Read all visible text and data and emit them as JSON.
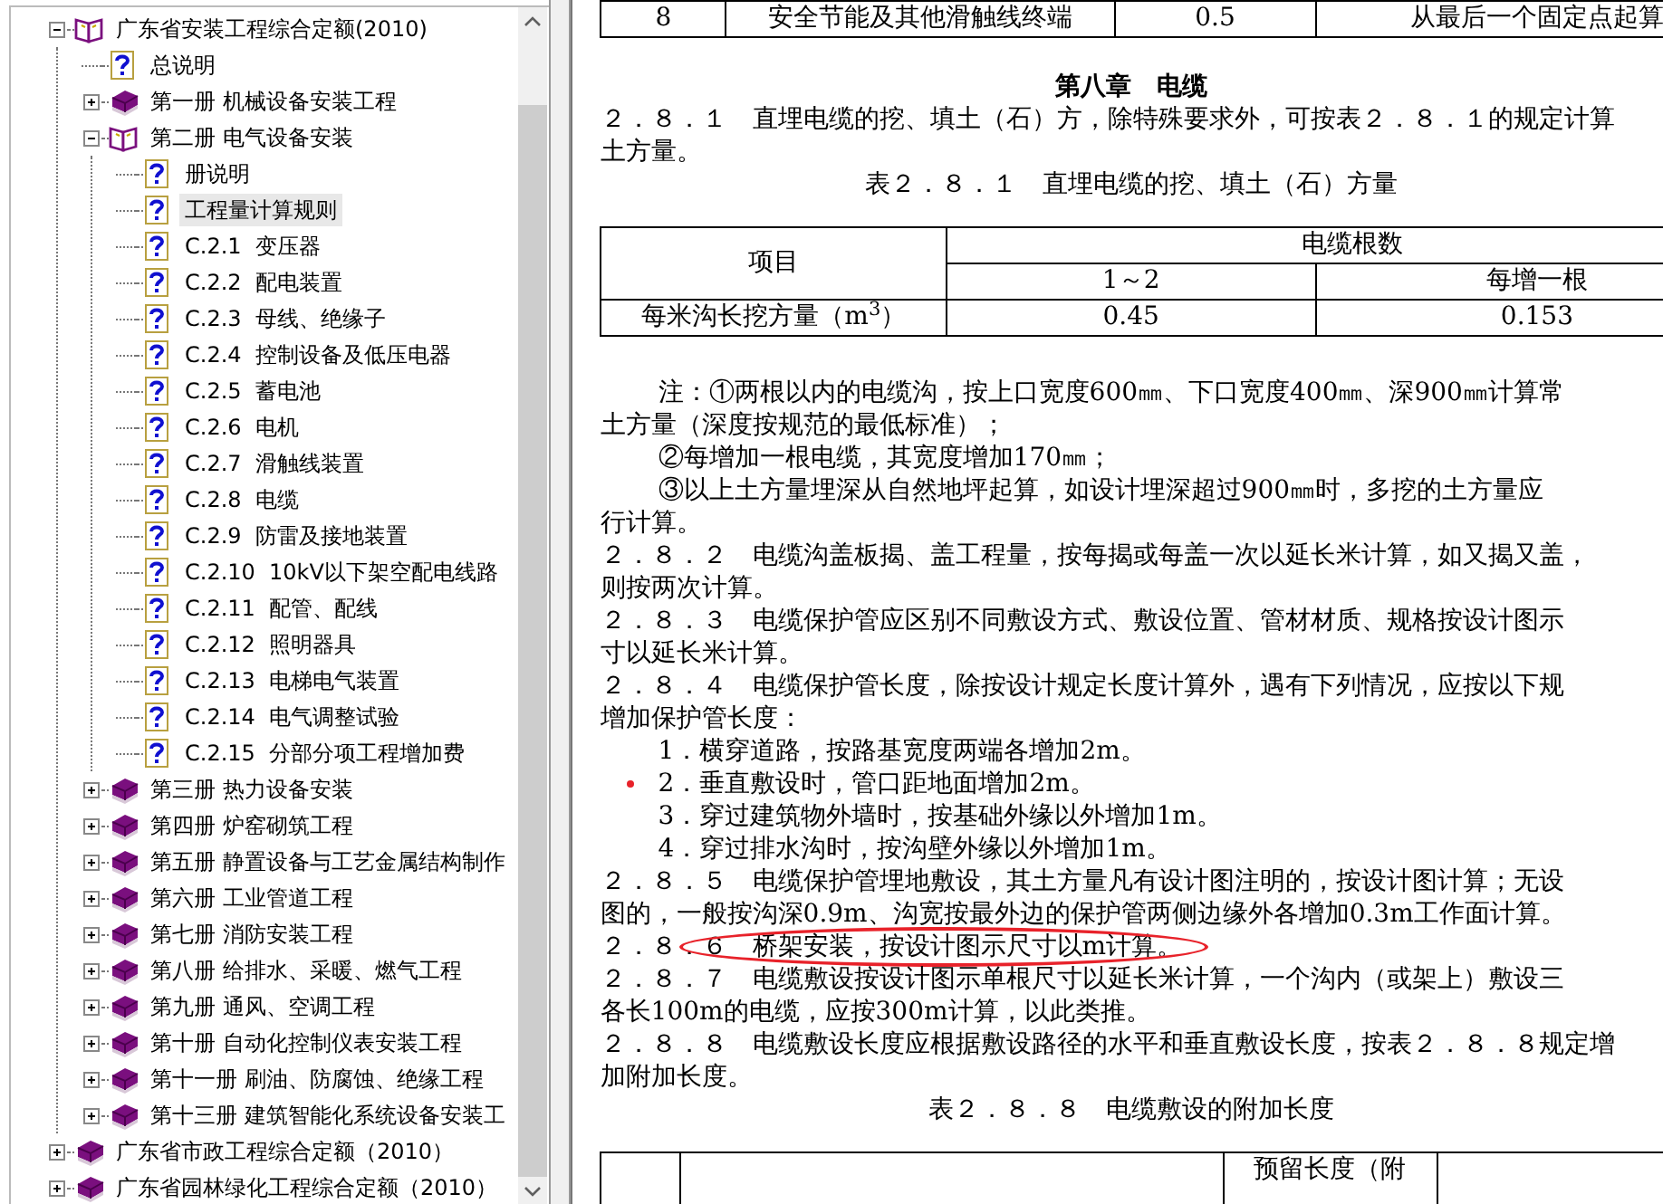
{
  "tree": [
    {
      "label": "广东省安装工程综合定额(2010)",
      "kind": "book",
      "expanded": true,
      "selected": false,
      "children": [
        {
          "label": "总说明",
          "kind": "page",
          "selected": false
        },
        {
          "label": "第一册 机械设备安装工程",
          "kind": "book",
          "expanded": false,
          "selected": false
        },
        {
          "label": "第二册 电气设备安装",
          "kind": "book",
          "expanded": true,
          "selected": false,
          "children": [
            {
              "label": "册说明",
              "kind": "page",
              "selected": false
            },
            {
              "label": "工程量计算规则",
              "kind": "page",
              "selected": true
            },
            {
              "label": "C.2.1  变压器",
              "kind": "page",
              "selected": false
            },
            {
              "label": "C.2.2  配电装置",
              "kind": "page",
              "selected": false
            },
            {
              "label": "C.2.3  母线、绝缘子",
              "kind": "page",
              "selected": false
            },
            {
              "label": "C.2.4  控制设备及低压电器",
              "kind": "page",
              "selected": false
            },
            {
              "label": "C.2.5  蓄电池",
              "kind": "page",
              "selected": false
            },
            {
              "label": "C.2.6  电机",
              "kind": "page",
              "selected": false
            },
            {
              "label": "C.2.7  滑触线装置",
              "kind": "page",
              "selected": false
            },
            {
              "label": "C.2.8  电缆",
              "kind": "page",
              "selected": false
            },
            {
              "label": "C.2.9  防雷及接地装置",
              "kind": "page",
              "selected": false
            },
            {
              "label": "C.2.10  10kV以下架空配电线路",
              "kind": "page",
              "selected": false
            },
            {
              "label": "C.2.11  配管、配线",
              "kind": "page",
              "selected": false
            },
            {
              "label": "C.2.12  照明器具",
              "kind": "page",
              "selected": false
            },
            {
              "label": "C.2.13  电梯电气装置",
              "kind": "page",
              "selected": false
            },
            {
              "label": "C.2.14  电气调整试验",
              "kind": "page",
              "selected": false
            },
            {
              "label": "C.2.15  分部分项工程增加费",
              "kind": "page",
              "selected": false
            }
          ]
        },
        {
          "label": "第三册 热力设备安装",
          "kind": "book",
          "expanded": false,
          "selected": false
        },
        {
          "label": "第四册 炉窑砌筑工程",
          "kind": "book",
          "expanded": false,
          "selected": false
        },
        {
          "label": "第五册 静置设备与工艺金属结构制作",
          "kind": "book",
          "expanded": false,
          "selected": false
        },
        {
          "label": "第六册 工业管道工程",
          "kind": "book",
          "expanded": false,
          "selected": false
        },
        {
          "label": "第七册 消防安装工程",
          "kind": "book",
          "expanded": false,
          "selected": false
        },
        {
          "label": "第八册 给排水、采暖、燃气工程",
          "kind": "book",
          "expanded": false,
          "selected": false
        },
        {
          "label": "第九册 通风、空调工程",
          "kind": "book",
          "expanded": false,
          "selected": false
        },
        {
          "label": "第十册 自动化控制仪表安装工程",
          "kind": "book",
          "expanded": false,
          "selected": false
        },
        {
          "label": "第十一册 刷油、防腐蚀、绝缘工程",
          "kind": "book",
          "expanded": false,
          "selected": false
        },
        {
          "label": "第十三册 建筑智能化系统设备安装工",
          "kind": "book",
          "expanded": false,
          "selected": false
        }
      ]
    },
    {
      "label": "广东省市政工程综合定额（2010）",
      "kind": "book",
      "expanded": false,
      "selected": false
    },
    {
      "label": "广东省园林绿化工程综合定额（2010）",
      "kind": "book",
      "expanded": false,
      "selected": false
    }
  ],
  "content": [
    {
      "kind": "table",
      "rows": [
        [
          "8",
          "安全节能及其他滑触线终端",
          "0.5",
          "从最后一个固定点起算"
        ]
      ]
    },
    {
      "kind": "heading",
      "text": "第八章　电缆"
    },
    {
      "kind": "line",
      "text": "２．８．１　直埋电缆的挖、填土（石）方，除特殊要求外，可按表２．８．１的规定计算"
    },
    {
      "kind": "line",
      "text": "土方量。"
    },
    {
      "kind": "caption",
      "text": "表２．８．１　直埋电缆的挖、填土（石）方量"
    },
    {
      "kind": "group_table",
      "row_header": "项目",
      "group": "电缆根数",
      "subheaders": [
        "1～2",
        "每增一根"
      ],
      "rows": [
        [
          "每米沟长挖方量（m$^{3}$）",
          "0.45",
          "0.153"
        ]
      ]
    },
    {
      "kind": "indented",
      "text": "注：①两根以内的电缆沟，按上口宽度600㎜、下口宽度400㎜、深900㎜计算常"
    },
    {
      "kind": "line",
      "text": "土方量（深度按规范的最低标准）；"
    },
    {
      "kind": "indented",
      "text": "②每增加一根电缆，其宽度增加170㎜；"
    },
    {
      "kind": "indented",
      "text": "③以上土方量埋深从自然地坪起算，如设计埋深超过900㎜时，多挖的土方量应"
    },
    {
      "kind": "line",
      "text": "行计算。"
    },
    {
      "kind": "line",
      "text": "２．８．２　电缆沟盖板揭、盖工程量，按每揭或每盖一次以延长米计算，如又揭又盖，"
    },
    {
      "kind": "line",
      "text": "则按两次计算。"
    },
    {
      "kind": "line",
      "text": "２．８．３　电缆保护管应区别不同敷设方式、敷设位置、管材材质、规格按设计图示"
    },
    {
      "kind": "line",
      "text": "寸以延长米计算。"
    },
    {
      "kind": "line",
      "text": "２．８．４　电缆保护管长度，除按设计规定长度计算外，遇有下列情况，应按以下规"
    },
    {
      "kind": "line",
      "text": "增加保护管长度："
    },
    {
      "kind": "indented",
      "text": "1．横穿道路，按路基宽度两端各增加2m。"
    },
    {
      "kind": "indented",
      "text": "2．垂直敷设时，管口距地面增加2m。",
      "marker": true
    },
    {
      "kind": "indented",
      "text": "3．穿过建筑物外墙时，按基础外缘以外增加1m。"
    },
    {
      "kind": "indented",
      "text": "4．穿过排水沟时，按沟壁外缘以外增加1m。"
    },
    {
      "kind": "line",
      "text": "２．８．５　电缆保护管埋地敷设，其土方量凡有设计图注明的，按设计图计算；无设"
    },
    {
      "kind": "line",
      "text": "图的，一般按沟深0.9m、沟宽按最外边的保护管两侧边缘外各增加0.3m工作面计算。"
    },
    {
      "kind": "line",
      "text": "２．８．６　桥架安装，按设计图示尺寸以m计算。",
      "circled": true
    },
    {
      "kind": "line",
      "text": "２．８．７　电缆敷设按设计图示单根尺寸以延长米计算，一个沟内（或架上）敷设三"
    },
    {
      "kind": "line",
      "text": "各长100m的电缆，应按300m计算，以此类推。"
    },
    {
      "kind": "line",
      "text": "２．８．８　电缆敷设长度应根据敷设路径的水平和垂直敷设长度，按表２．８．８规定增"
    },
    {
      "kind": "line",
      "text": "加附加长度。"
    },
    {
      "kind": "caption",
      "text": "表２．８．８　电缆敷设的附加长度"
    },
    {
      "kind": "partial_table",
      "column_3": "预留长度（附"
    }
  ]
}
